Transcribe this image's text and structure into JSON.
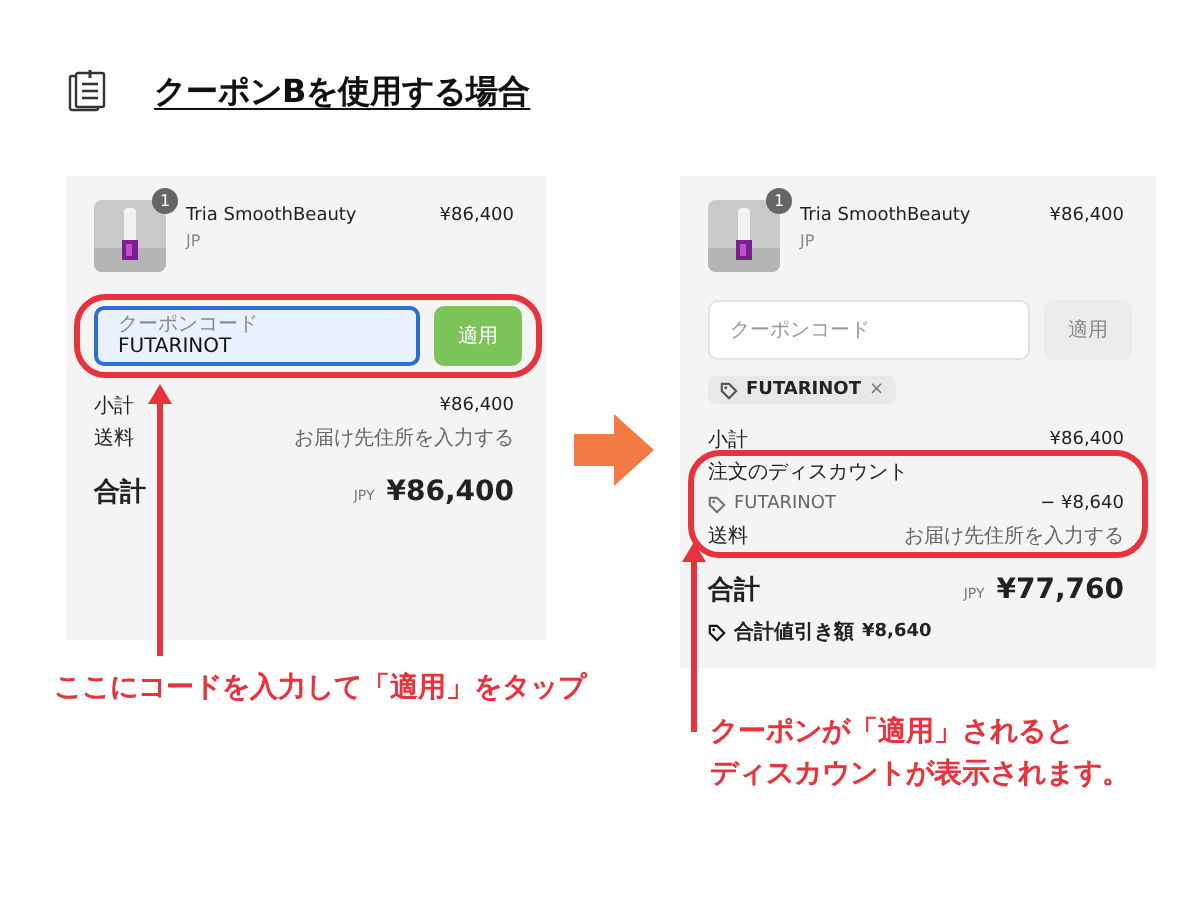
{
  "title": "クーポンBを使用する場合",
  "panels": [
    {
      "product": {
        "name": "Tria SmoothBeauty",
        "variant": "JP",
        "price": "¥86,400",
        "quantity": "1"
      },
      "coupon": {
        "label": "クーポンコード",
        "value": "FUTARINOT",
        "focused": true,
        "highlighted": true
      },
      "apply_button": {
        "label": "適用",
        "disabled": false
      },
      "sections": [
        {
          "highlighted": false,
          "lines": [
            {
              "kind": "row",
              "label": "小計",
              "value": "¥86,400"
            },
            {
              "kind": "note",
              "label": "送料",
              "value": "お届け先住所を入力する"
            },
            {
              "kind": "total",
              "label": "合計",
              "currency": "JPY",
              "value": "¥86,400"
            }
          ]
        }
      ],
      "caption": [
        "ここにコードを入力して「適用」をタップ"
      ]
    },
    {
      "product": {
        "name": "Tria SmoothBeauty",
        "variant": "JP",
        "price": "¥86,400",
        "quantity": "1"
      },
      "coupon": {
        "placeholder": "クーポンコード",
        "focused": false,
        "highlighted": false
      },
      "apply_button": {
        "label": "適用",
        "disabled": true
      },
      "applied_codes": [
        {
          "code": "FUTARINOT",
          "remove": "×"
        }
      ],
      "sections": [
        {
          "highlighted": false,
          "lines": [
            {
              "kind": "row",
              "label": "小計",
              "value": "¥86,400"
            }
          ]
        },
        {
          "highlighted": true,
          "lines": [
            {
              "kind": "heading",
              "label": "注文のディスカウント"
            },
            {
              "kind": "discount",
              "label": "FUTARINOT",
              "value": "− ¥8,640"
            },
            {
              "kind": "note",
              "label": "送料",
              "value": "お届け先住所を入力する"
            }
          ]
        },
        {
          "highlighted": false,
          "lines": [
            {
              "kind": "total",
              "label": "合計",
              "currency": "JPY",
              "value": "¥77,760"
            },
            {
              "kind": "savings",
              "label": "合計値引き額",
              "value": "¥8,640"
            }
          ]
        }
      ],
      "caption": [
        "クーポンが「適用」されると",
        "ディスカウントが表示されます。"
      ]
    }
  ]
}
